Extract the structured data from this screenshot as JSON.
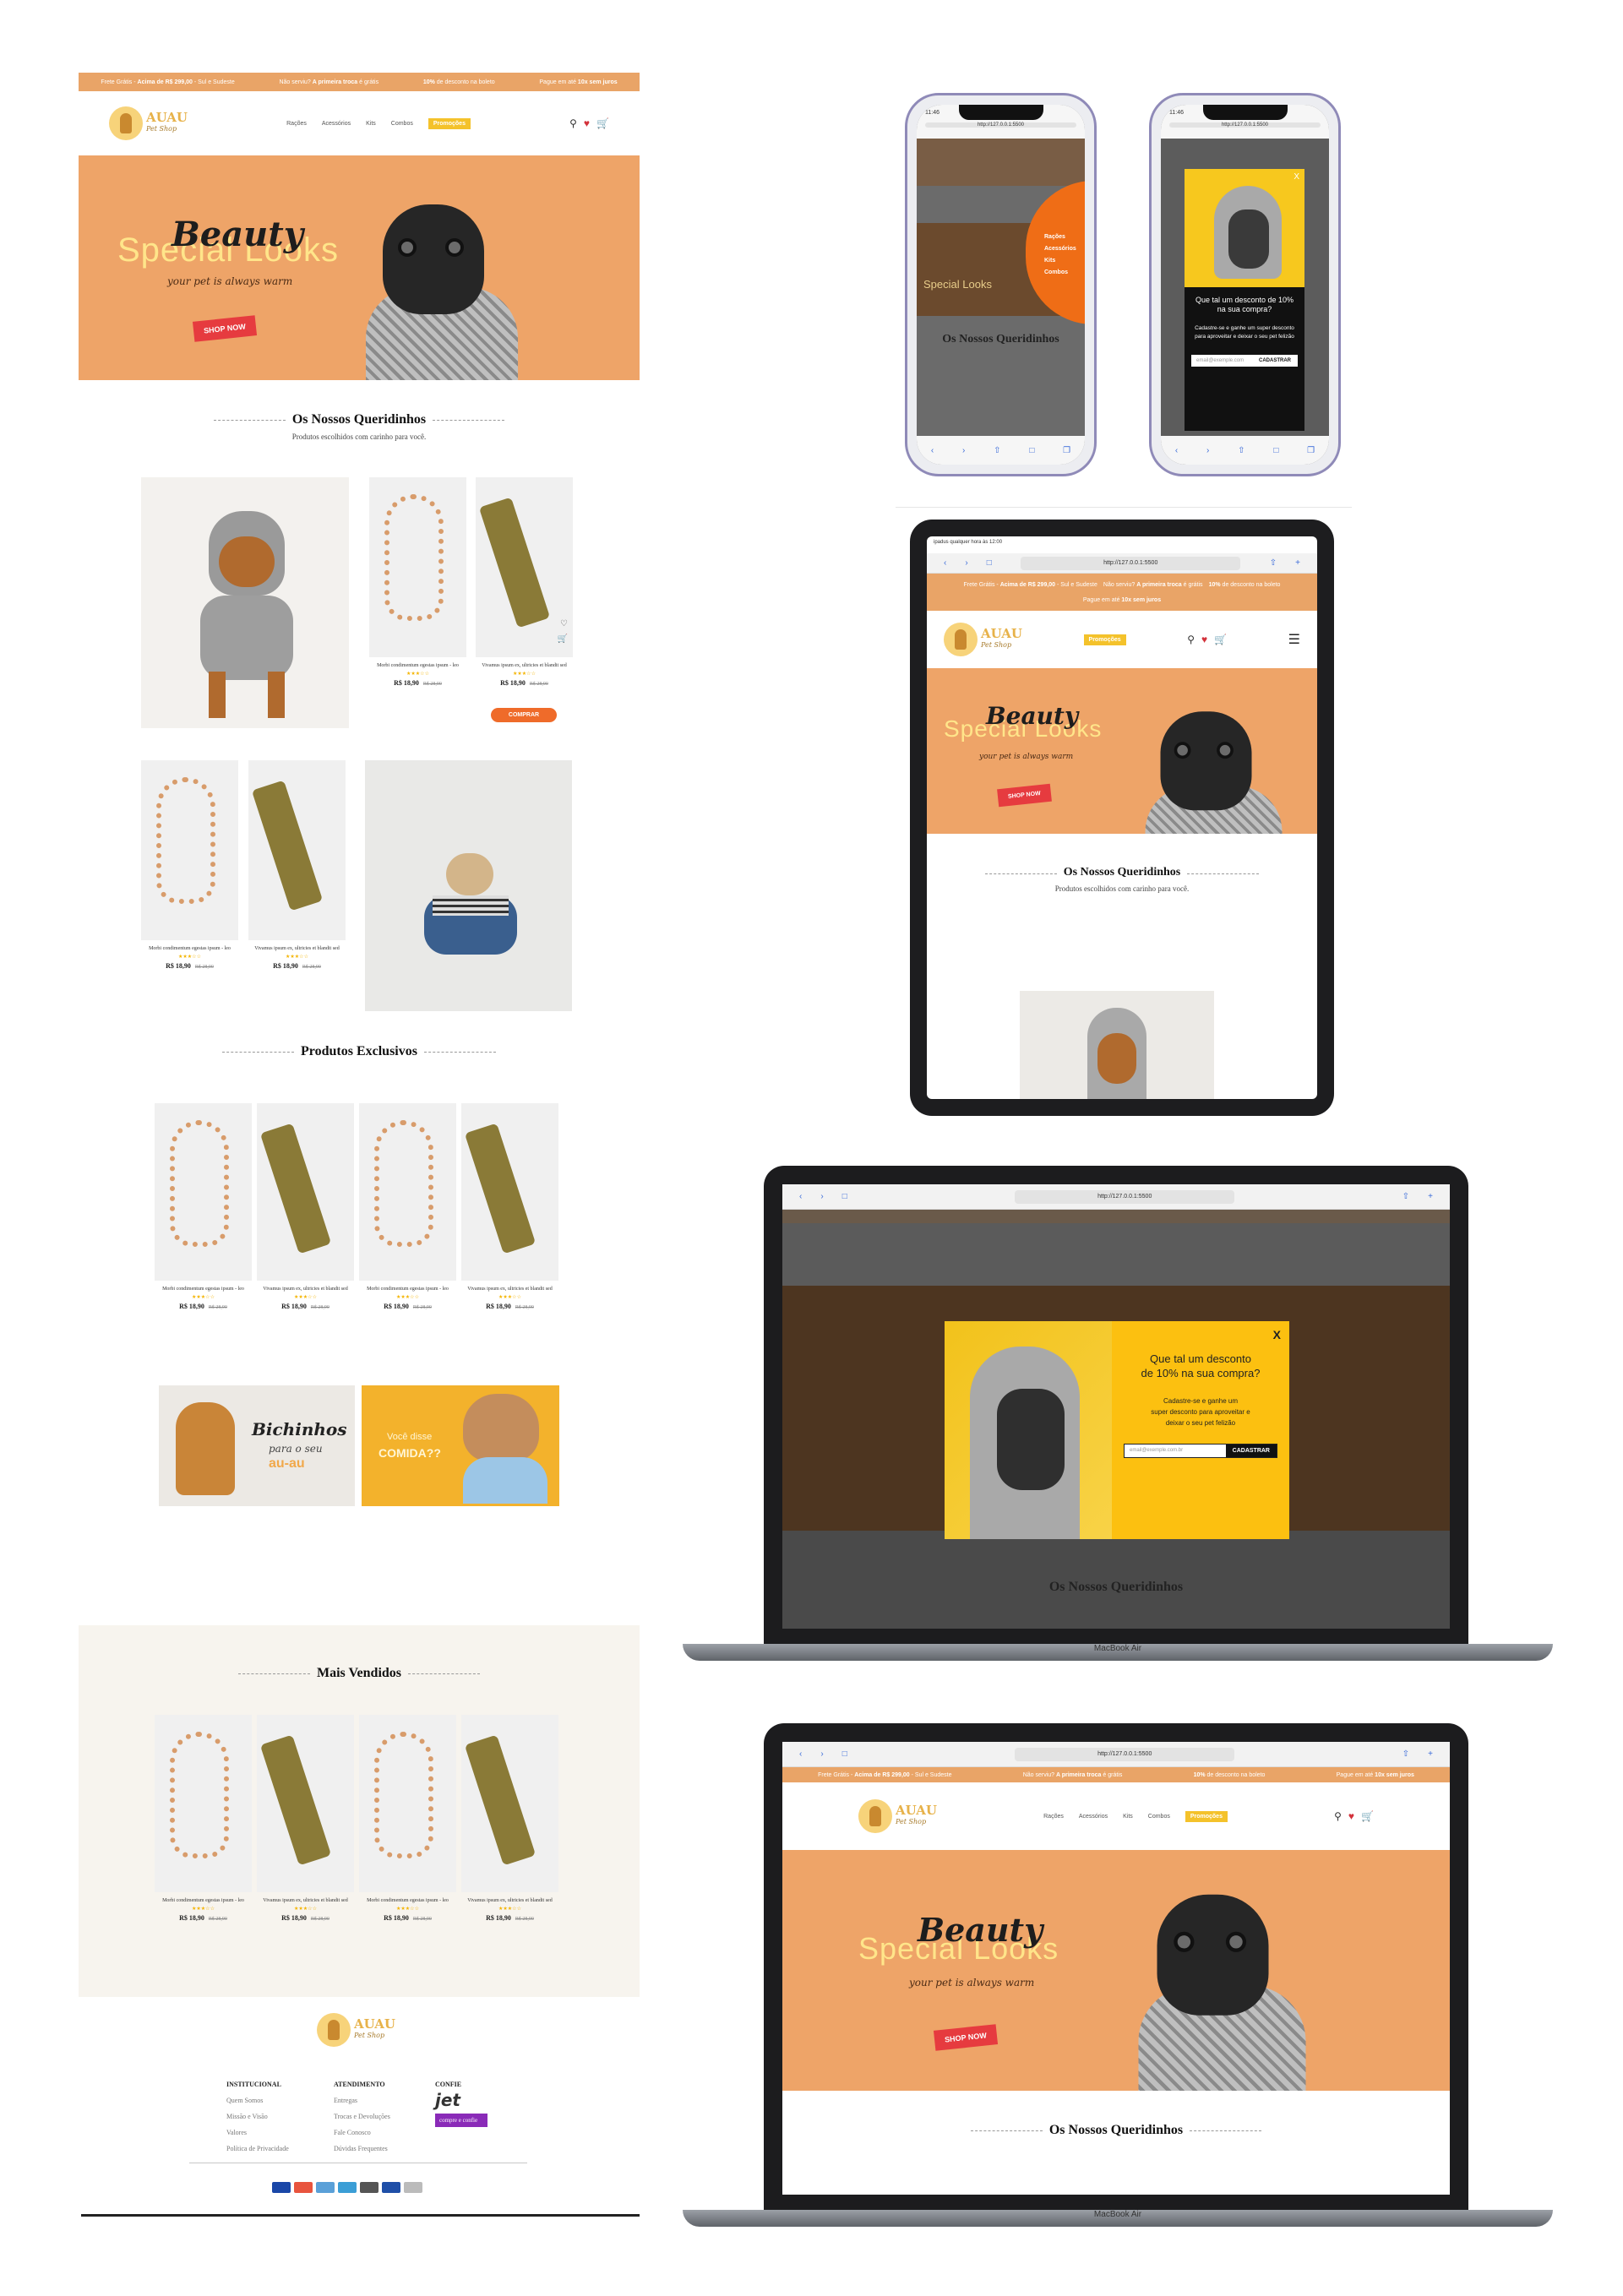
{
  "topbar": {
    "items": [
      {
        "pre": "Frete Grátis - ",
        "bold": "Acima de R$ 299,00",
        "post": " - Sul e Sudeste"
      },
      {
        "pre": "Não serviu? ",
        "bold": "A primeira troca",
        "post": " é grátis"
      },
      {
        "pre": "",
        "bold": "10%",
        "post": " de desconto na boleto"
      },
      {
        "pre": "Pague em até ",
        "bold": "10x sem juros",
        "post": ""
      }
    ]
  },
  "logo": {
    "name": "AUAU",
    "tagline": "Pet Shop"
  },
  "nav": {
    "items": [
      "Rações",
      "Acessórios",
      "Kits",
      "Combos"
    ],
    "promo": "Promoções"
  },
  "hero": {
    "script": "Beauty",
    "headline": "Special Looks",
    "subtitle": "your pet is always warm",
    "cta": "SHOP NOW"
  },
  "favorites": {
    "title": "Os Nossos Queridinhos",
    "subtitle": "Produtos escolhidos com carinho para você."
  },
  "products": {
    "p1": {
      "name": "Morbi condimentum egestas ipsum - leo",
      "price": "R$ 18,90",
      "old": "R$ 28,90",
      "stars": "★★★☆☆"
    },
    "p2": {
      "name": "Vivamus ipsum ex, ultricies et blandit sed",
      "price": "R$ 18,90",
      "old": "R$ 28,90",
      "stars": "★★★☆☆"
    }
  },
  "buy_label": "COMPRAR",
  "exclusive": {
    "title": "Produtos Exclusivos"
  },
  "banners": {
    "b1": {
      "line1": "Bichinhos",
      "line2": "para o seu",
      "line3": "au-au"
    },
    "b2": {
      "line1": "Você disse",
      "line2": "COMIDA??"
    }
  },
  "bestsellers": {
    "title": "Mais Vendidos"
  },
  "footer": {
    "col1": {
      "title": "INSTITUCIONAL",
      "links": [
        "Quem Somos",
        "Missão e Visão",
        "Valores",
        "Política de Privacidade"
      ]
    },
    "col2": {
      "title": "ATENDIMENTO",
      "links": [
        "Entregas",
        "Trocas e Devoluções",
        "Fale Conosco",
        "Dúvidas Frequentes"
      ]
    },
    "col3": {
      "title": "CONFIE",
      "badge1": "jet",
      "badge2": "compre e confie"
    }
  },
  "popup": {
    "q1": "Que tal um desconto",
    "q2": "de 10% na sua compra?",
    "p1": "Cadastre-se e ganhe um",
    "p2": "super desconto para aproveitar e",
    "p3": "deixar o seu pet felizão",
    "placeholder": "email@exemple.com.br",
    "button": "CADASTRAR",
    "close": "X"
  },
  "mobile": {
    "status_time": "11:46",
    "url": "http://127.0.0.1:5500",
    "menu_items": [
      "Rações",
      "Acessórios",
      "Kits",
      "Combos"
    ],
    "popup_q": "Que tal um desconto de 10% na sua compra?",
    "popup_p": "Cadastre-se e ganhe um super desconto para aproveitar e deixar o seu pet felizão",
    "popup_placeholder": "email@exemple.com",
    "popup_button": "CADASTRAR"
  },
  "tablet": {
    "status": "ipadus qualquer hora às 12:00",
    "url": "http://127.0.0.1:5500"
  },
  "laptop": {
    "model": "MacBook Air",
    "url": "http://127.0.0.1:5500"
  },
  "colors": {
    "accent": "#eea468",
    "promo": "#f4c22b",
    "buy": "#ef6b2a",
    "popup": "#fcc010"
  }
}
